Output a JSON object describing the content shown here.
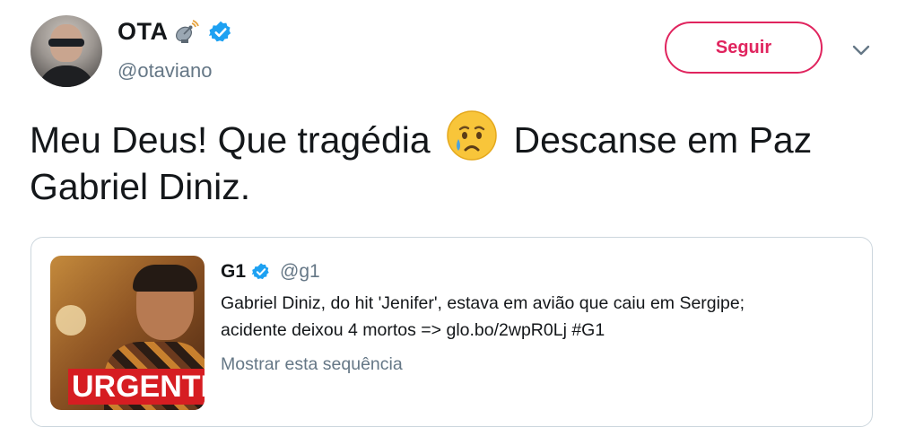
{
  "author": {
    "display_name": "OTA",
    "handle": "@otaviano",
    "verified": true,
    "name_icon": "satellite-icon"
  },
  "actions": {
    "follow_label": "Seguir",
    "menu_icon": "chevron-down-icon"
  },
  "tweet": {
    "text_part1": "Meu Deus! Que tragédia",
    "emoji": "crying-face-emoji",
    "text_part2": "Descanse em Paz Gabriel Diniz."
  },
  "quoted_tweet": {
    "display_name": "G1",
    "handle": "@g1",
    "verified": true,
    "text_line1": "Gabriel Diniz, do hit 'Jenifer', estava em avião que caiu em Sergipe;",
    "text_line2": "acidente deixou 4 mortos =>  glo.bo/2wpR0Lj #G1",
    "show_thread_label": "Mostrar esta sequência",
    "thumbnail_label": "URGENTE"
  },
  "colors": {
    "accent": "#e0245e",
    "verified_blue": "#1da1f2",
    "secondary_text": "#657786",
    "border": "#ccd6dd"
  }
}
